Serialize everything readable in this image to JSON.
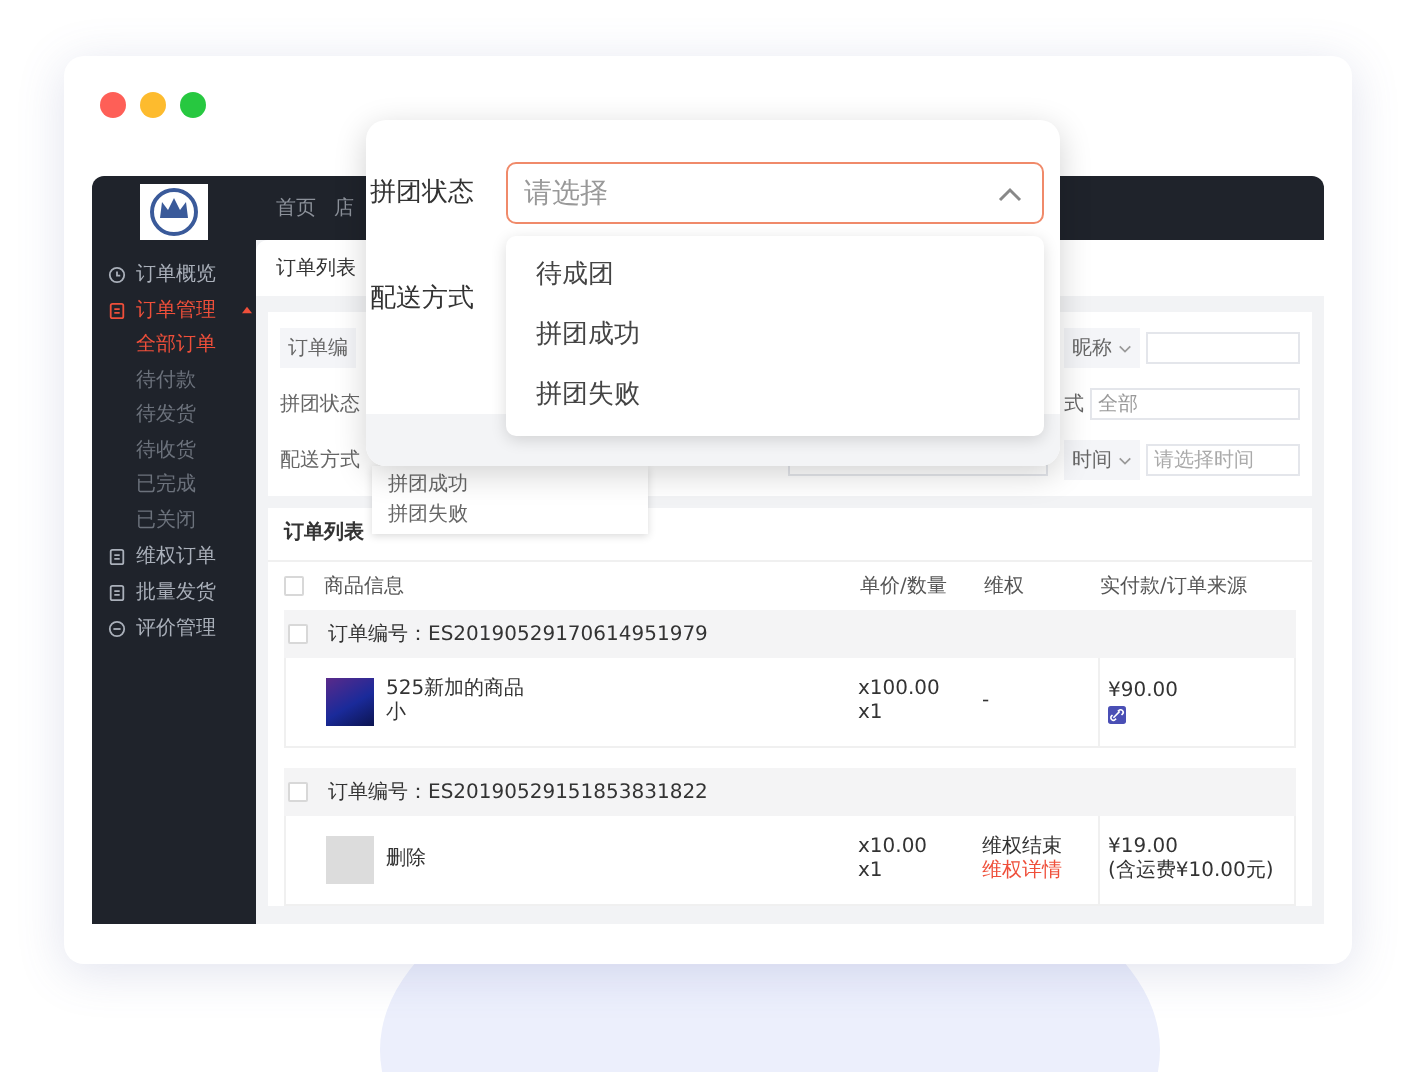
{
  "window": {
    "controls": [
      {
        "color": "#fe5f57"
      },
      {
        "color": "#fdbb2e"
      },
      {
        "color": "#27c840"
      }
    ]
  },
  "app": {
    "top_nav": [
      "首页",
      "店"
    ],
    "sidebar": {
      "items": [
        {
          "label": "订单概览",
          "selected": false
        },
        {
          "label": "订单管理",
          "selected": true,
          "expanded": true,
          "children": [
            {
              "label": "全部订单",
              "selected": true
            },
            {
              "label": "待付款",
              "selected": false
            },
            {
              "label": "待发货",
              "selected": false
            },
            {
              "label": "待收货",
              "selected": false
            },
            {
              "label": "已完成",
              "selected": false
            },
            {
              "label": "已关闭",
              "selected": false
            }
          ]
        },
        {
          "label": "维权订单",
          "selected": false
        },
        {
          "label": "批量发货",
          "selected": false
        },
        {
          "label": "评价管理",
          "selected": false
        }
      ]
    },
    "tab": "订单列表",
    "filters": {
      "order_no_select": "订单编",
      "group_status_label": "拼团状态",
      "delivery_label": "配送方式",
      "nickname_select": "昵称",
      "method_label": "式",
      "method_field": "全部",
      "time_select": "时间",
      "time_field": {
        "placeholder": "请选择时间"
      },
      "delivery_options": [
        "拼团成功",
        "拼团失败"
      ]
    },
    "order_list": {
      "title": "订单列表",
      "select_all_checked": false,
      "columns": [
        "商品信息",
        "单价/数量",
        "维权",
        "实付款/订单来源"
      ],
      "orders": [
        {
          "number": "订单编号：ES20190529170614951979",
          "checked": false,
          "product": "525新加的商品",
          "spec": "小",
          "price": "x100.00",
          "quantity": "x1",
          "rights": [
            {
              "text": "-",
              "kind": "plain"
            }
          ],
          "paid": [
            "¥90.00"
          ],
          "source_badge": true
        },
        {
          "number": "订单编号：ES20190529151853831822",
          "checked": false,
          "product": "删除",
          "price": "x10.00",
          "quantity": "x1",
          "rights": [
            {
              "text": "维权结束",
              "kind": "plain"
            },
            {
              "text": "维权详情",
              "kind": "link"
            }
          ],
          "paid": [
            "¥19.00",
            "(含运费¥10.00元)"
          ]
        }
      ]
    }
  },
  "popup": {
    "status_label": "拼团状态",
    "status_select": {
      "placeholder": "请选择",
      "expanded": true,
      "options": [
        {
          "label": "待成团",
          "selected": false
        },
        {
          "label": "拼团成功",
          "selected": false
        },
        {
          "label": "拼团失败",
          "selected": false
        }
      ]
    },
    "delivery_label": "配送方式"
  }
}
